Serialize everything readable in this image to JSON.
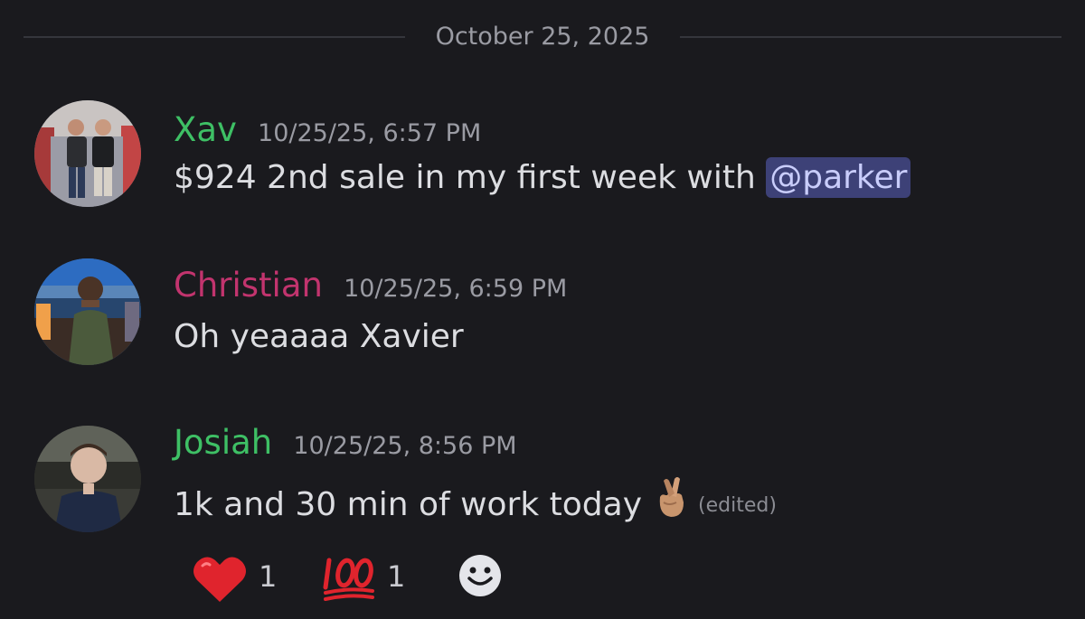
{
  "date_divider": "October 25, 2025",
  "colors": {
    "background": "#1a1a1e",
    "xav": "#3ec065",
    "christian": "#c2346e",
    "josiah": "#3ec065",
    "mention_bg": "#3d4177",
    "timestamp": "#9a9ba3"
  },
  "messages": [
    {
      "username": "Xav",
      "timestamp": "10/25/25, 6:57 PM",
      "text_before": "$924 2nd sale in my first week with ",
      "mention": "@parker",
      "avatar_icon": "avatar-photo-icon"
    },
    {
      "username": "Christian",
      "timestamp": "10/25/25, 6:59 PM",
      "text": "Oh yeaaaa Xavier",
      "avatar_icon": "avatar-photo-icon"
    },
    {
      "username": "Josiah",
      "timestamp": "10/25/25, 8:56 PM",
      "text": "1k and 30 min of work today",
      "emoji": "crossed-fingers-icon",
      "edited_label": "(edited)",
      "avatar_icon": "avatar-photo-icon"
    }
  ],
  "reactions": [
    {
      "emoji": "heart-icon",
      "count": "1"
    },
    {
      "emoji": "hundred-points-icon",
      "count": "1"
    }
  ],
  "add_reaction_icon": "add-reaction-icon"
}
